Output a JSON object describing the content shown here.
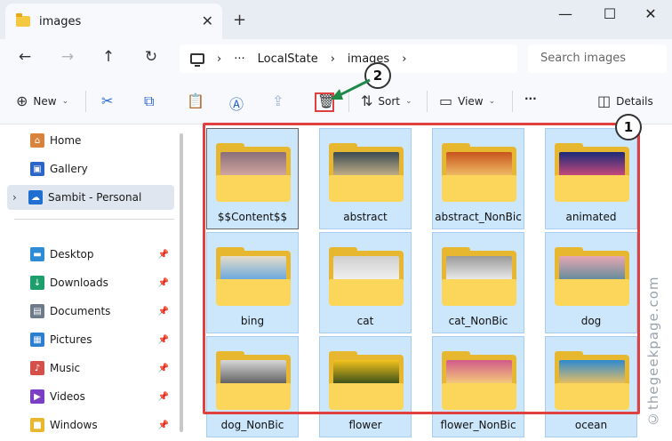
{
  "window": {
    "tab_title": "images",
    "tab_close": "✕",
    "new_tab": "+",
    "minimize": "—",
    "maximize": "☐",
    "close": "✕"
  },
  "nav": {
    "back": "←",
    "forward": "→",
    "up": "↑",
    "refresh": "↻"
  },
  "address": {
    "ellipsis": "···",
    "sep": "›",
    "crumbs": [
      "LocalState",
      "images"
    ],
    "search_placeholder": "Search images"
  },
  "toolbar": {
    "new_label": "New",
    "sort_label": "Sort",
    "view_label": "View",
    "more_label": "···",
    "details_label": "Details",
    "chev": "⌄"
  },
  "sidebar": {
    "items": [
      {
        "label": "Home",
        "icon": "home-icon",
        "color": "#d9823b"
      },
      {
        "label": "Gallery",
        "icon": "gallery-icon",
        "color": "#2b66c7"
      },
      {
        "label": "Sambit - Personal",
        "icon": "onedrive-icon",
        "color": "#1f6fd1"
      },
      {
        "label": "Desktop",
        "icon": "desktop-icon",
        "color": "#2e8bd6"
      },
      {
        "label": "Downloads",
        "icon": "download-icon",
        "color": "#1e9e6a"
      },
      {
        "label": "Documents",
        "icon": "documents-icon",
        "color": "#6d7a8a"
      },
      {
        "label": "Pictures",
        "icon": "pictures-icon",
        "color": "#2b7fd1"
      },
      {
        "label": "Music",
        "icon": "music-icon",
        "color": "#d6504a"
      },
      {
        "label": "Videos",
        "icon": "videos-icon",
        "color": "#7a3fc4"
      },
      {
        "label": "Windows",
        "icon": "folder-icon",
        "color": "#e8b730"
      }
    ],
    "pin": "📌",
    "expand": "›"
  },
  "folders": [
    {
      "label": "$$Content$$",
      "thumb": [
        "#8a6f7a",
        "#d6a9a0"
      ]
    },
    {
      "label": "abstract",
      "thumb": [
        "#3b4a52",
        "#c9b58a"
      ]
    },
    {
      "label": "abstract_NonBic",
      "thumb": [
        "#c8541e",
        "#f1c26a"
      ]
    },
    {
      "label": "animated",
      "thumb": [
        "#1a2a7a",
        "#d24a7a"
      ]
    },
    {
      "label": "bing",
      "thumb": [
        "#e6dcc8",
        "#62a6e0"
      ]
    },
    {
      "label": "cat",
      "thumb": [
        "#cfcfcf",
        "#f2f2f2"
      ]
    },
    {
      "label": "cat_NonBic",
      "thumb": [
        "#9a9a9a",
        "#efefef"
      ]
    },
    {
      "label": "dog",
      "thumb": [
        "#e6a7b2",
        "#5e8a9a"
      ]
    },
    {
      "label": "dog_NonBic",
      "thumb": [
        "#d8d8d8",
        "#5a5a5a"
      ]
    },
    {
      "label": "flower",
      "thumb": [
        "#f3c21c",
        "#2f4a1a"
      ]
    },
    {
      "label": "flower_NonBic",
      "thumb": [
        "#d15a8a",
        "#f7d27a"
      ]
    },
    {
      "label": "ocean",
      "thumb": [
        "#2d8ad1",
        "#f3c25a"
      ]
    }
  ],
  "annotations": {
    "badge1": "1",
    "badge2": "2",
    "accent": "#e14040",
    "arrow_color": "#1e8a4a"
  },
  "watermark": "©thegeekpage.com"
}
